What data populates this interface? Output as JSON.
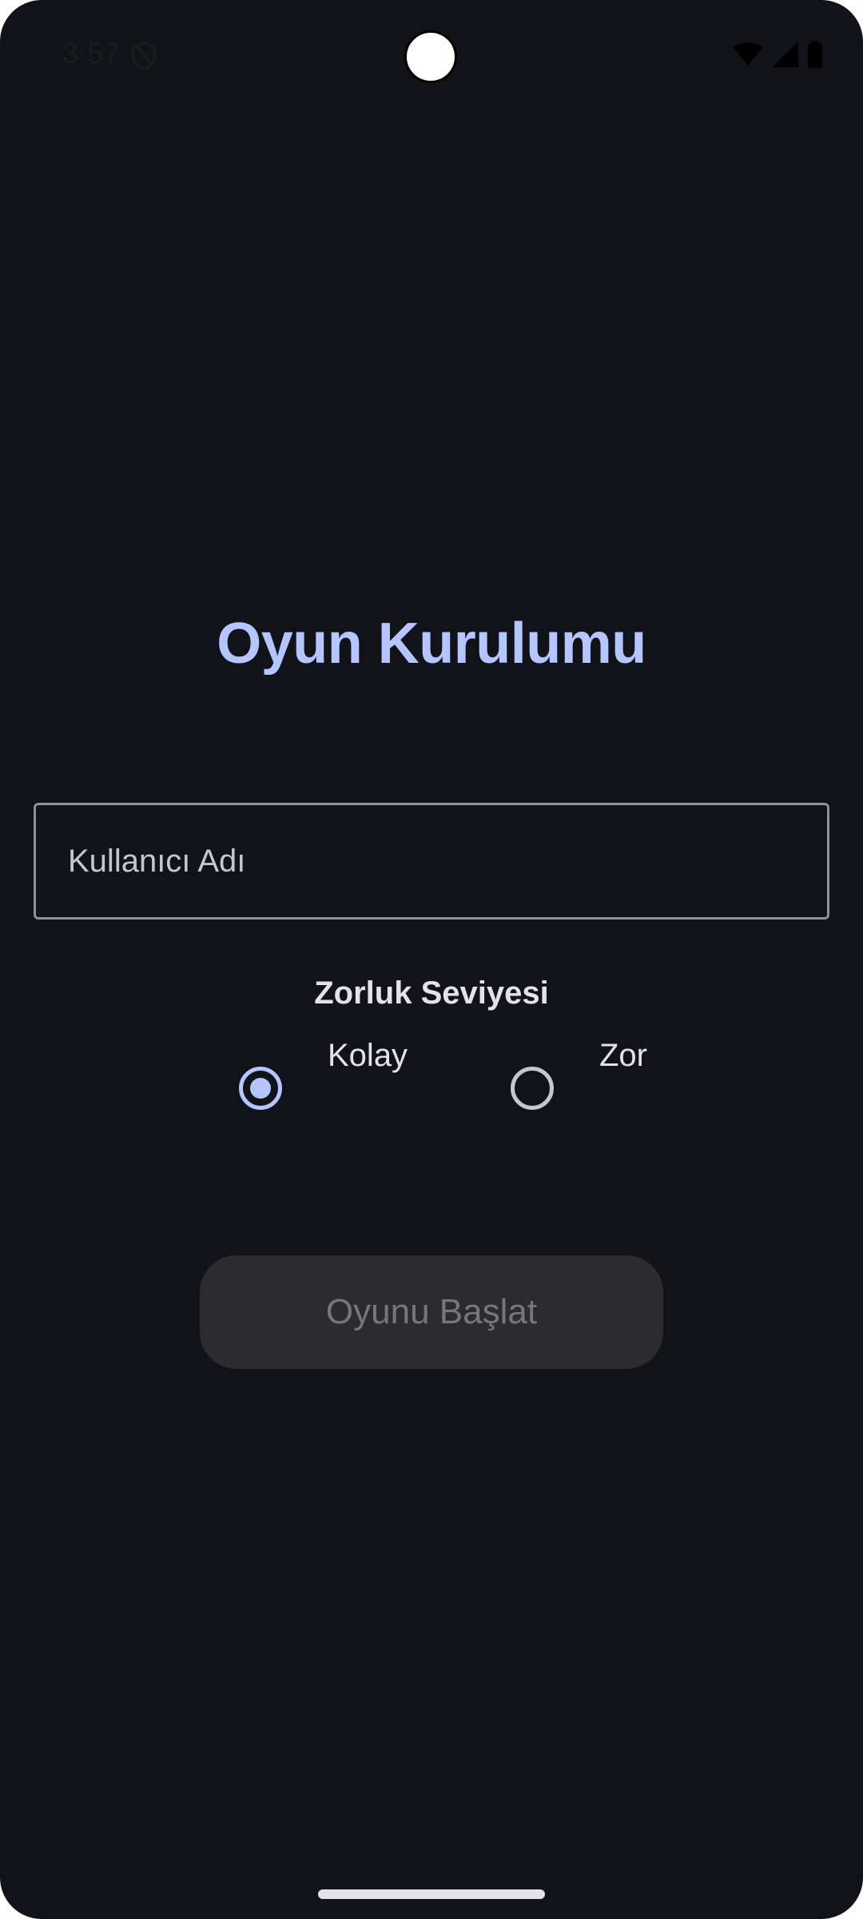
{
  "status_bar": {
    "time": "3:57",
    "icons": [
      "shield-icon",
      "wifi-icon",
      "signal-icon",
      "battery-icon"
    ]
  },
  "screen": {
    "title": "Oyun Kurulumu"
  },
  "form": {
    "username": {
      "placeholder": "Kullanıcı Adı",
      "value": ""
    },
    "difficulty": {
      "label": "Zorluk Seviyesi",
      "options": [
        {
          "label": "Kolay",
          "selected": true
        },
        {
          "label": "Zor",
          "selected": false
        }
      ]
    },
    "start_button": {
      "label": "Oyunu Başlat",
      "enabled": false
    }
  },
  "colors": {
    "background": "#121318",
    "accent": "#b4c5ff",
    "text": "#e3e2e9",
    "outline": "#8f9099",
    "button_disabled_bg": "#2b2b30",
    "button_disabled_text": "#76777d"
  }
}
